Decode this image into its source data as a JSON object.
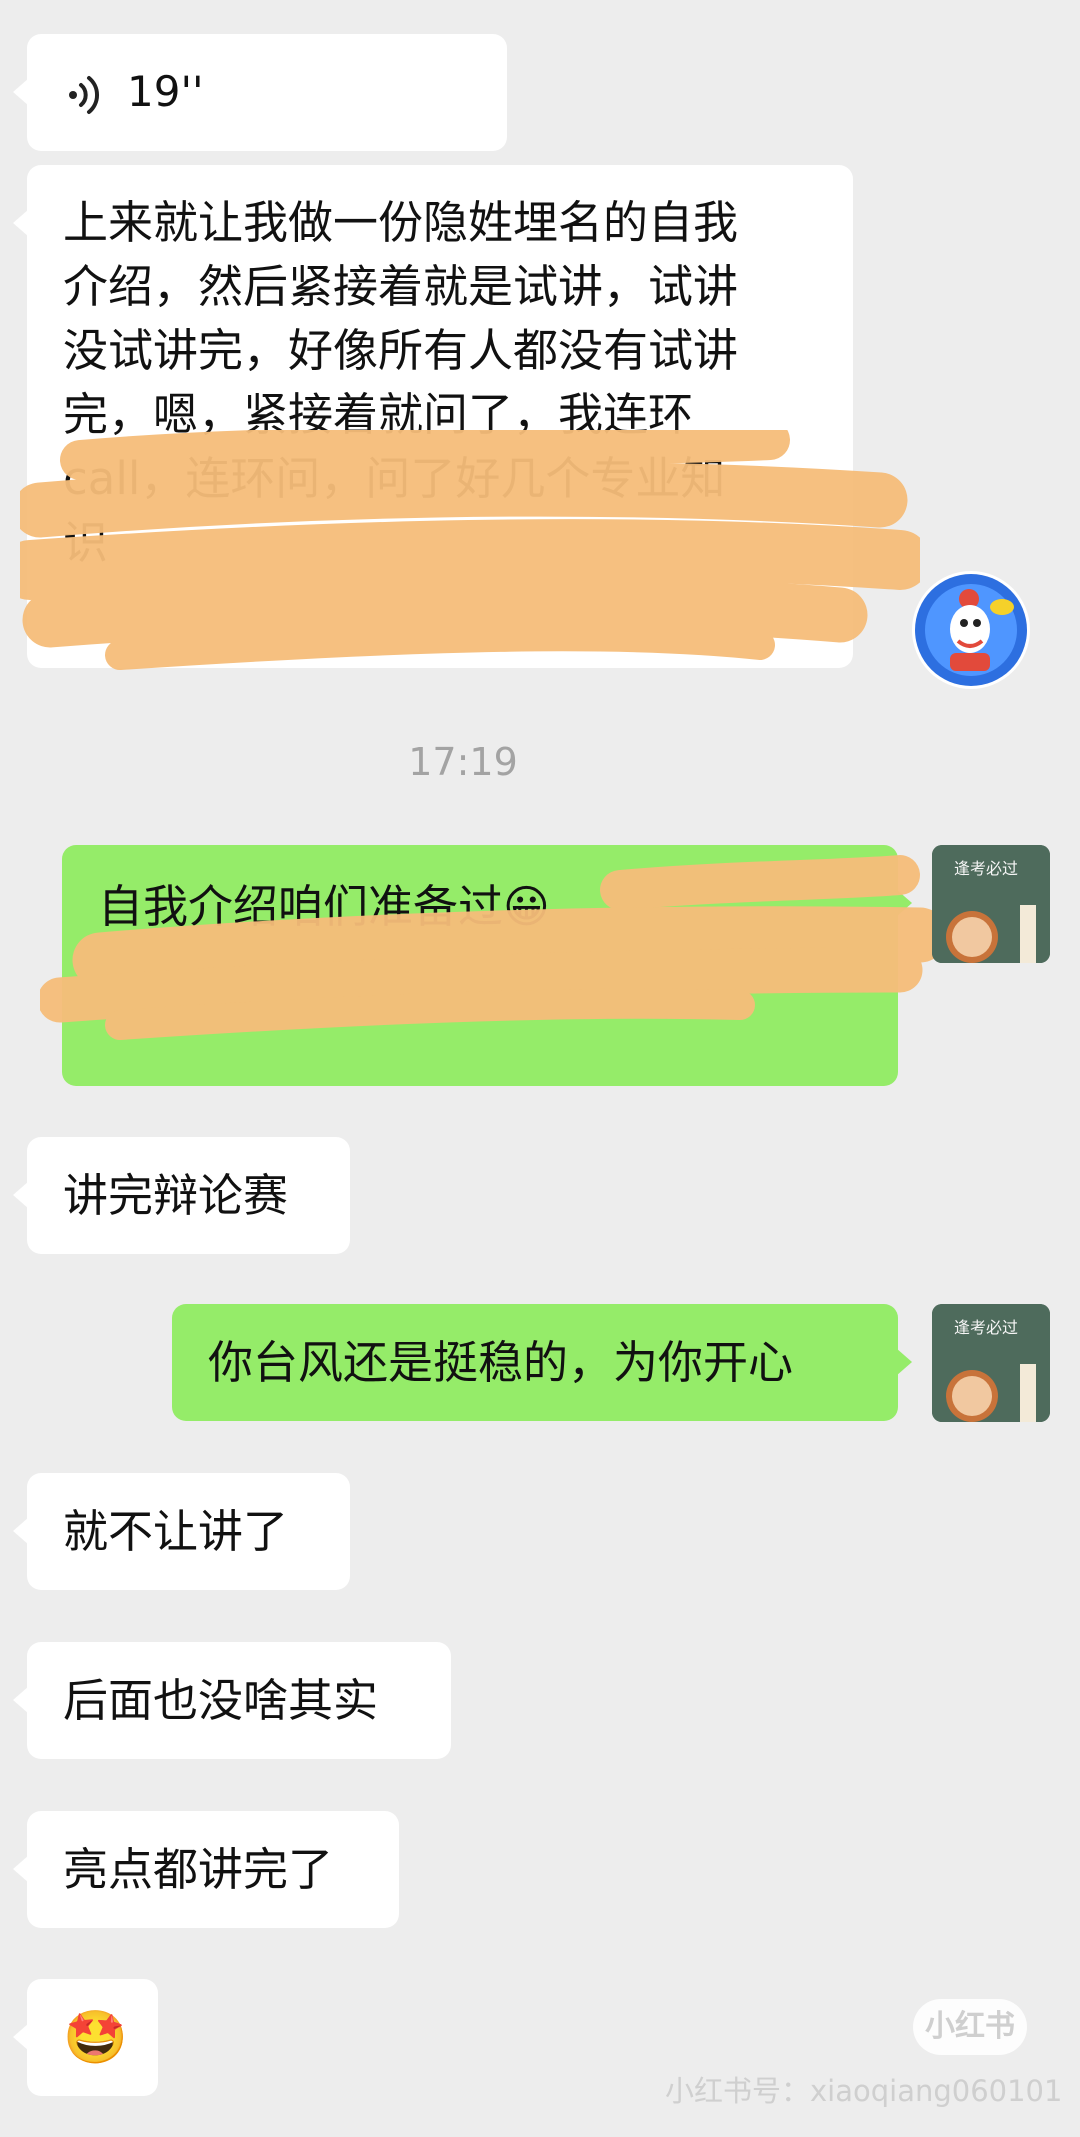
{
  "messages": {
    "m1_voice": {
      "duration": "19''"
    },
    "m2_text": {
      "lines": [
        "上来就让我做一份隐姓埋名的自我",
        "介绍，然后紧接着就是试讲，试讲",
        "没试讲完，好像所有人都没有试讲",
        "完，嗯，紧接着就问了，我连环",
        "call，连环问，问了好几个专业知",
        "识"
      ]
    },
    "timestamp": "17:19",
    "m3_text": {
      "lines": [
        "自我介绍咱们准备过😀",
        ""
      ]
    },
    "m4_text": "讲完辩论赛",
    "m5_text": "你台风还是挺稳的，为你开心",
    "m6_text": "就不让讲了",
    "m7_text": "后面也没啥其实",
    "m8_text": "亮点都讲完了",
    "m9_emoji": "🤩"
  },
  "avatars": {
    "other_label": "",
    "self_label": "逢考必过"
  },
  "watermark": {
    "logo": "小红书",
    "id_text": "小红书号：xiaoqiang060101"
  },
  "colors": {
    "background": "#ededed",
    "left_bubble": "#ffffff",
    "right_bubble": "#95ec69",
    "scribble": "#f6bd7a"
  }
}
